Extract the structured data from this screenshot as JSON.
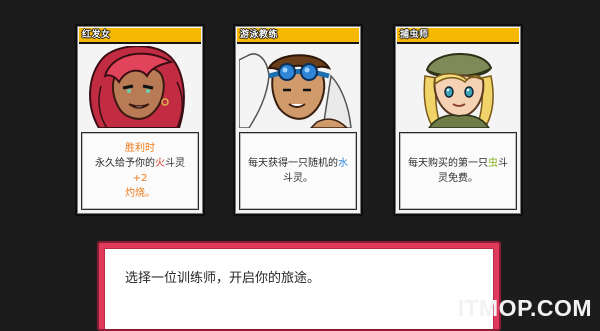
{
  "trainers": [
    {
      "name": "红发女",
      "desc": {
        "line1": "胜利时",
        "line2_pre": "永久给予你的",
        "line2_hl1": "火",
        "line2_mid": "斗灵",
        "line2_hl2": "+2",
        "line3": "灼烧。"
      },
      "hair_color": "#d0344a",
      "icon": "red-haired-woman-portrait"
    },
    {
      "name": "游泳教练",
      "desc": {
        "line1_pre": "每天获得一只随机的",
        "line1_hl": "水",
        "line2": "斗灵。"
      },
      "hair_color": "#7a4a22",
      "icon": "swim-coach-portrait"
    },
    {
      "name": "捕虫师",
      "desc": {
        "line1": "每天购买的第一只",
        "line1_hl": "虫",
        "line1_post": "斗",
        "line2": "灵免费。"
      },
      "hair_color": "#f0d46a",
      "icon": "bug-catcher-portrait"
    }
  ],
  "dialog": {
    "text": "选择一位训练师，开启你的旅途。"
  },
  "watermark": {
    "text": "ITMOP.COM"
  },
  "colors": {
    "card_header": "#f6b800",
    "dialog_border": "#e03a5c",
    "fire": "#ee7a1a",
    "water": "#2f85d6",
    "bug": "#86b51f"
  }
}
